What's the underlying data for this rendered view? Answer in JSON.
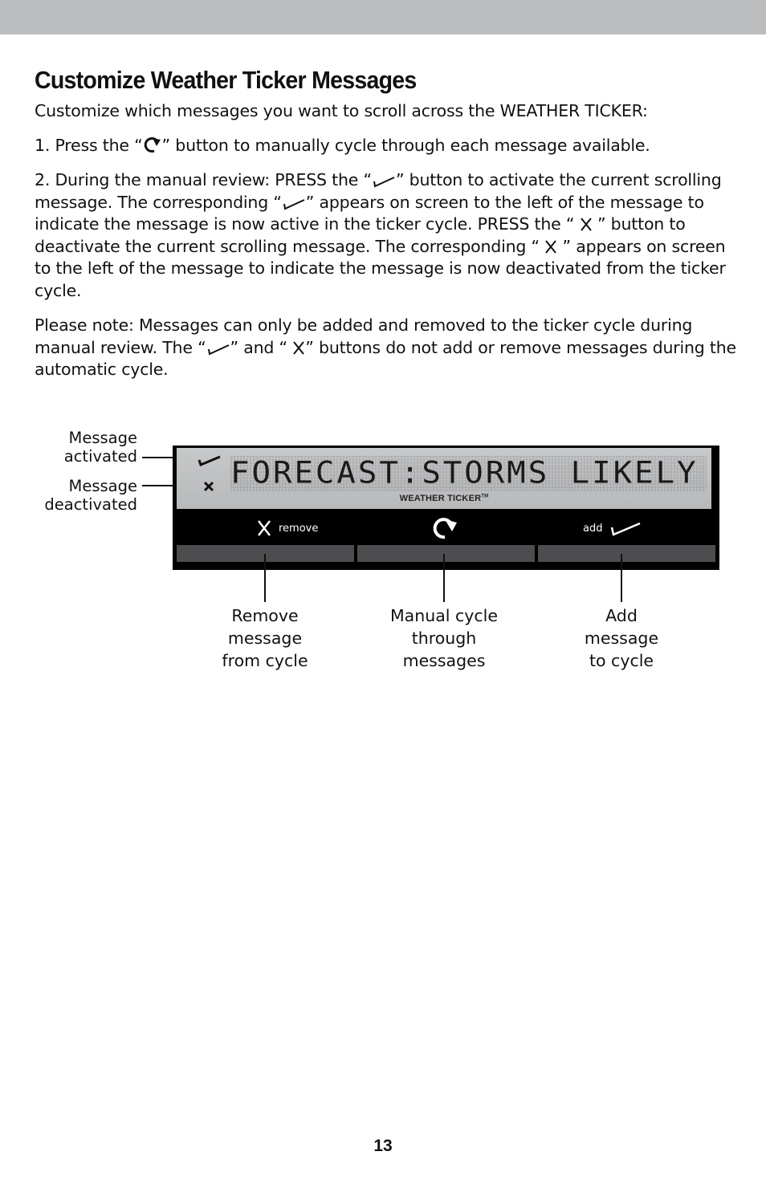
{
  "page": {
    "title": "Customize Weather Ticker Messages",
    "page_number": "13"
  },
  "body": {
    "intro": "Customize which messages you want to scroll across the WEATHER TICKER:",
    "step1": {
      "prefix": "1. Press the “",
      "icon": "cycle-arrow-icon",
      "suffix": "” button to manually cycle through each message available."
    },
    "step2": {
      "part1": "2. During the manual review: PRESS the “",
      "icon1": "check-icon",
      "part2": "” button to activate the current scrolling message. The corresponding “",
      "icon2": "check-icon",
      "part3": "” appears on screen to the left of the message to indicate the message is now active in the ticker cycle. PRESS the “ ",
      "icon3": "x-icon",
      "part4": " ” button to deactivate the current scrolling message. The corresponding “ ",
      "icon4": "x-icon",
      "part5": " ” appears on screen to the left of the message to indicate the message is now deactivated from the ticker cycle."
    },
    "note": {
      "part1": "Please note: Messages can only be added and removed to the ticker cycle during manual review. The “",
      "icon1": "check-icon",
      "part2": "” and “ ",
      "icon2": "x-icon",
      "part3": "” buttons do not add or remove messages during the automatic cycle."
    }
  },
  "diagram": {
    "side_labels": {
      "activated": "Message\nactivated",
      "deactivated": "Message\ndeactivated"
    },
    "lcd": {
      "message": "FORECAST:STORMS LIKELY",
      "brand": "WEATHER TICKER",
      "trademark": "TM"
    },
    "buttons": {
      "remove": {
        "label": "remove",
        "icon": "x-icon"
      },
      "cycle": {
        "label": "",
        "icon": "cycle-arrow-icon"
      },
      "add": {
        "label": "add",
        "icon": "check-icon"
      }
    },
    "callouts": {
      "remove": "Remove\nmessage\nfrom cycle",
      "cycle": "Manual cycle\nthrough\nmessages",
      "add": "Add\nmessage\nto cycle"
    },
    "colors": {
      "lcd_background": "#bcbdbf",
      "device_body": "#000000",
      "key_caps": "#4d4d4f",
      "header_bar": "#bcbdbf"
    }
  }
}
